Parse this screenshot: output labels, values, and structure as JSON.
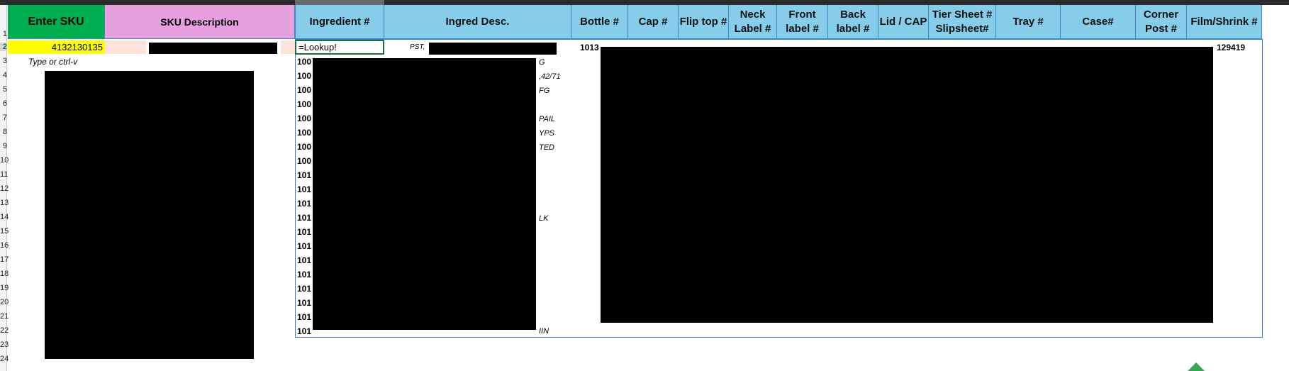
{
  "headers": {
    "enter_sku": "Enter SKU",
    "sku_description": "SKU Description",
    "ingredient_num": "Ingredient #",
    "ingred_desc": "Ingred Desc.",
    "bottle": "Bottle #",
    "cap": "Cap #",
    "flip_top": "Flip top  #",
    "neck_label": "Neck Label #",
    "front_label": "Front label #",
    "back_label": "Back label #",
    "lid_cap": "Lid / CAP",
    "tier_sheet": "Tier Sheet # Slipsheet#",
    "tray": "Tray #",
    "case": "Case#",
    "corner_post": "Corner Post #",
    "film_shrink": "Film/Shrink #"
  },
  "cells": {
    "sku_value": "4132130135",
    "hint": "Type or ctrl-v",
    "formula": "=Lookup!",
    "pst": "PST,",
    "bottle_value": "1013",
    "film_value": "129419"
  },
  "row_numbers": [
    "1",
    "2",
    "3",
    "4",
    "5",
    "6",
    "7",
    "8",
    "9",
    "10",
    "11",
    "12",
    "13",
    "14",
    "15",
    "16",
    "17",
    "18",
    "19",
    "20",
    "21",
    "22",
    "23",
    "24"
  ],
  "ingredient_prefixes": [
    "100",
    "100",
    "100",
    "100",
    "100",
    "100",
    "100",
    "100",
    "101",
    "101",
    "101",
    "101",
    "101",
    "101",
    "101",
    "101",
    "101",
    "101",
    "101",
    "101"
  ],
  "ingredient_last": "101",
  "desc_tails": [
    "G",
    ",42/71",
    "FG",
    "",
    "PAIL",
    "YPS",
    "TED",
    "",
    "",
    "",
    "",
    "LK",
    "",
    "",
    "",
    "",
    "",
    "",
    "",
    "IIN"
  ],
  "colors": {
    "green": "#00b050",
    "pink": "#e6a0de",
    "blue": "#86cdea",
    "yellow": "#ffff00",
    "light_peach": "#fde3d9",
    "selection": "#1e6f3c"
  }
}
